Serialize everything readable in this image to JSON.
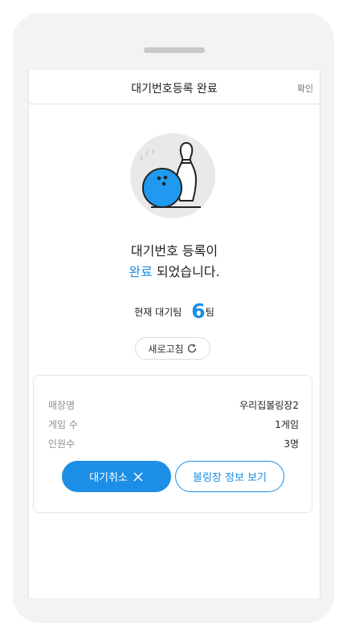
{
  "header": {
    "title": "대기번호등록 완료",
    "confirm_label": "확인"
  },
  "message": {
    "line1": "대기번호 등록이",
    "line2_accent": "완료",
    "line2_rest": " 되었습니다."
  },
  "waiting": {
    "label": "현재 대기팀",
    "count": "6",
    "unit": "팀"
  },
  "refresh": {
    "label": "새로고침"
  },
  "details": [
    {
      "label": "매장명",
      "value": "우리집볼링장2"
    },
    {
      "label": "게임 수",
      "value": "1게임"
    },
    {
      "label": "인원수",
      "value": "3명"
    }
  ],
  "buttons": {
    "cancel_label": "대기취소",
    "info_label": "볼링장 정보 보기"
  },
  "colors": {
    "accent": "#1c8ee6",
    "ball": "#1f9af0"
  }
}
